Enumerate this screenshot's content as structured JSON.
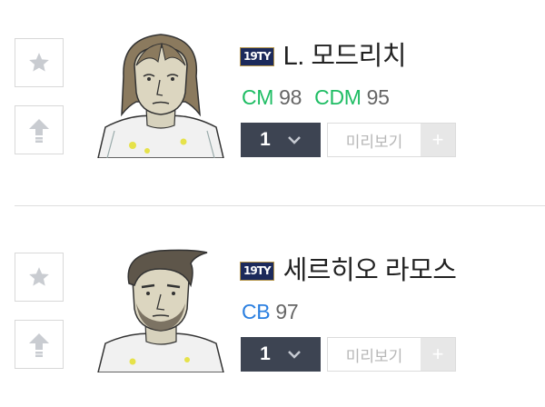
{
  "players": [
    {
      "season_badge": "19TY",
      "name": "L. 모드리치",
      "positions": [
        {
          "pos": "CM",
          "ovr": "98",
          "color": "#1fbd64"
        },
        {
          "pos": "CDM",
          "ovr": "95",
          "color": "#1fbd64"
        }
      ],
      "level": "1",
      "preview_label": "미리보기",
      "plus_label": "+"
    },
    {
      "season_badge": "19TY",
      "name": "세르히오 라모스",
      "positions": [
        {
          "pos": "CB",
          "ovr": "97",
          "color": "#2b7fe0"
        }
      ],
      "level": "1",
      "preview_label": "미리보기",
      "plus_label": "+"
    }
  ],
  "icons": {
    "favorite": "star-icon",
    "upgrade": "arrow-up-icon",
    "level_dropdown": "chevron-down-icon"
  },
  "colors": {
    "badge_bg": "#1c2a5b",
    "level_bg": "#3d4452",
    "attacker_green": "#1fbd64",
    "defender_blue": "#2b7fe0"
  }
}
